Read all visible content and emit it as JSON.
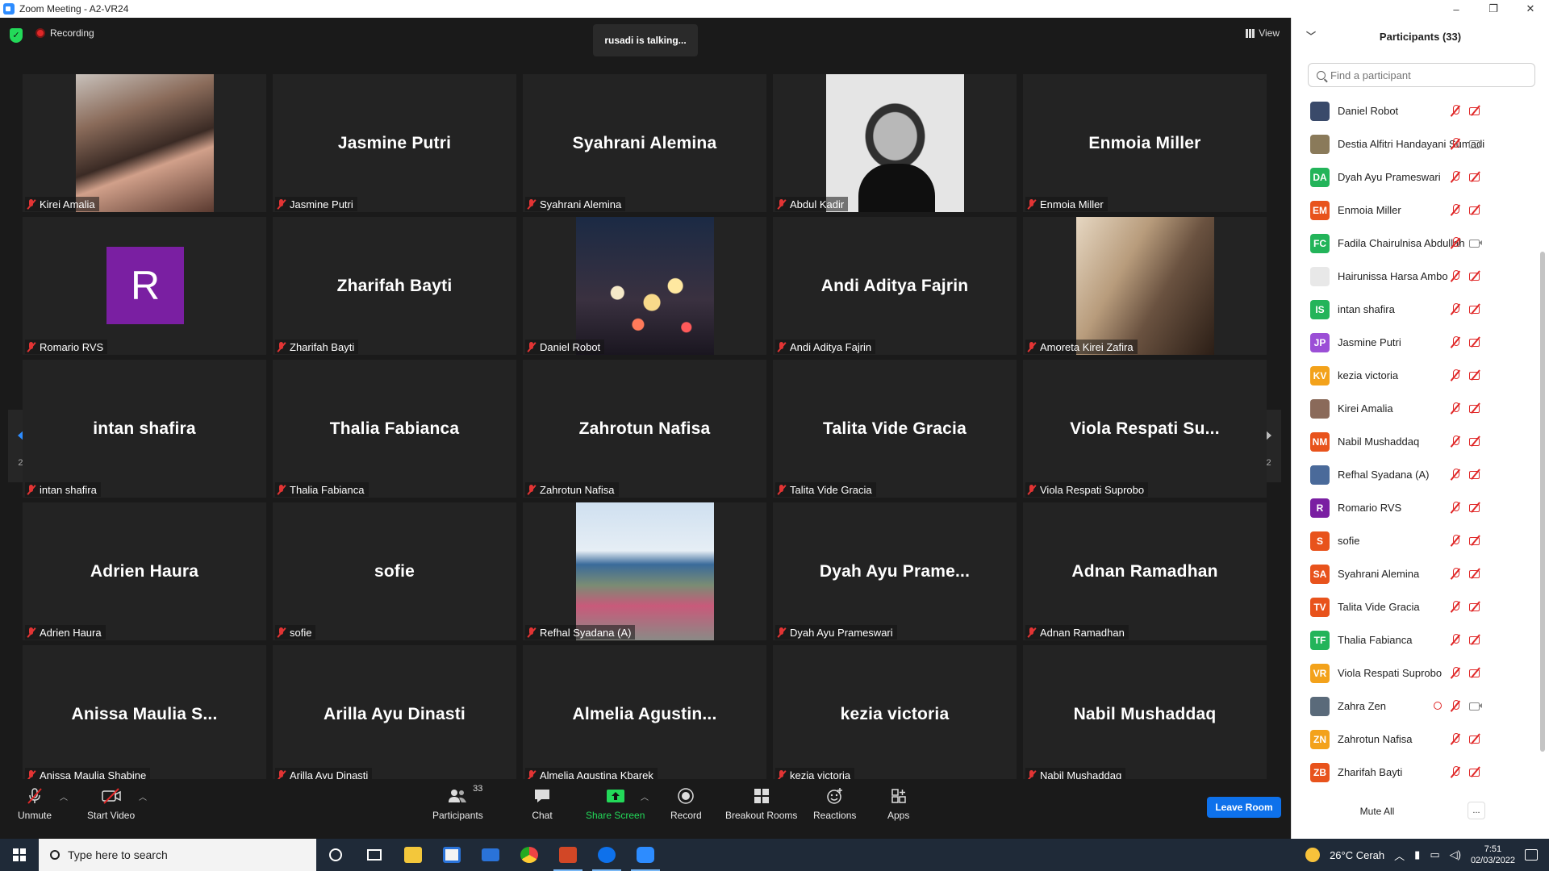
{
  "window": {
    "title": "Zoom Meeting - A2-VR24",
    "minimize": "–",
    "maximize": "❐",
    "close": "✕"
  },
  "topbar": {
    "recording": "Recording",
    "talking": "rusadi is talking...",
    "view": "View"
  },
  "gallery": {
    "page_indicator": "2/2",
    "tiles": [
      {
        "name": "Kirei Amalia",
        "display": "",
        "video": "v-kirei"
      },
      {
        "name": "Jasmine Putri",
        "display": "Jasmine Putri",
        "video": ""
      },
      {
        "name": "Syahrani Alemina",
        "display": "Syahrani Alemina",
        "video": ""
      },
      {
        "name": "Abdul Kadir",
        "display": "",
        "video": "v-abdul"
      },
      {
        "name": "Enmoia Miller",
        "display": "Enmoia Miller",
        "video": ""
      },
      {
        "name": "Romario RVS",
        "display": "",
        "video": "",
        "avatar": "R"
      },
      {
        "name": "Zharifah Bayti",
        "display": "Zharifah Bayti",
        "video": ""
      },
      {
        "name": "Daniel Robot",
        "display": "",
        "video": "v-daniel"
      },
      {
        "name": "Andi Aditya Fajrin",
        "display": "Andi Aditya Fajrin",
        "video": ""
      },
      {
        "name": "Amoreta Kirei Zafira",
        "display": "",
        "video": "v-amoreta"
      },
      {
        "name": "intan shafira",
        "display": "intan shafira",
        "video": ""
      },
      {
        "name": "Thalia Fabianca",
        "display": "Thalia Fabianca",
        "video": ""
      },
      {
        "name": "Zahrotun Nafisa",
        "display": "Zahrotun Nafisa",
        "video": ""
      },
      {
        "name": "Talita Vide Gracia",
        "display": "Talita Vide Gracia",
        "video": ""
      },
      {
        "name": "Viola Respati Suprobo",
        "display": "Viola  Respati  Su...",
        "video": ""
      },
      {
        "name": "Adrien Haura",
        "display": "Adrien Haura",
        "video": ""
      },
      {
        "name": "sofie",
        "display": "sofie",
        "video": ""
      },
      {
        "name": "Refhal Syadana (A)",
        "display": "",
        "video": "v-refhal"
      },
      {
        "name": "Dyah Ayu Prameswari",
        "display": "Dyah  Ayu  Prame...",
        "video": ""
      },
      {
        "name": "Adnan Ramadhan",
        "display": "Adnan Ramadhan",
        "video": ""
      },
      {
        "name": "Anissa Maulia Shabine",
        "display": "Anissa  Maulia  S...",
        "video": ""
      },
      {
        "name": "Arilla Ayu Dinasti",
        "display": "Arilla Ayu Dinasti",
        "video": ""
      },
      {
        "name": "Almelia Agustina Kbarek",
        "display": "Almelia  Agustin...",
        "video": ""
      },
      {
        "name": "kezia victoria",
        "display": "kezia victoria",
        "video": ""
      },
      {
        "name": "Nabil Mushaddaq",
        "display": "Nabil Mushaddaq",
        "video": ""
      }
    ]
  },
  "toolbar": {
    "unmute": "Unmute",
    "start_video": "Start Video",
    "participants": "Participants",
    "participants_count": "33",
    "chat": "Chat",
    "share_screen": "Share Screen",
    "record": "Record",
    "breakout_rooms": "Breakout Rooms",
    "reactions": "Reactions",
    "apps": "Apps",
    "leave": "Leave Room"
  },
  "panel": {
    "title": "Participants (33)",
    "search_placeholder": "Find a participant",
    "mute_all": "Mute All",
    "more": "...",
    "participants": [
      {
        "name": "Daniel Robot",
        "initials": "",
        "color": "#3a4a6a",
        "cam": "off",
        "pin": false
      },
      {
        "name": "Destia Alfitri Handayani Sumadi",
        "initials": "",
        "color": "#8a7a5a",
        "cam": "on",
        "pin": false
      },
      {
        "name": "Dyah Ayu Prameswari",
        "initials": "DA",
        "color": "#23b45a",
        "cam": "off",
        "pin": false
      },
      {
        "name": "Enmoia Miller",
        "initials": "EM",
        "color": "#e8531c",
        "cam": "off",
        "pin": false
      },
      {
        "name": "Fadila Chairulnisa Abdullah",
        "initials": "FC",
        "color": "#23b45a",
        "cam": "on",
        "pin": false
      },
      {
        "name": "Hairunissa Harsa Ambo",
        "initials": "",
        "color": "#e8e8e8",
        "cam": "off",
        "pin": false
      },
      {
        "name": "intan shafira",
        "initials": "IS",
        "color": "#23b45a",
        "cam": "off",
        "pin": false
      },
      {
        "name": "Jasmine Putri",
        "initials": "JP",
        "color": "#9b4fd6",
        "cam": "off",
        "pin": false
      },
      {
        "name": "kezia victoria",
        "initials": "KV",
        "color": "#f3a21b",
        "cam": "off",
        "pin": false
      },
      {
        "name": "Kirei Amalia",
        "initials": "",
        "color": "#8a6a5a",
        "cam": "off",
        "pin": false
      },
      {
        "name": "Nabil Mushaddaq",
        "initials": "NM",
        "color": "#e8531c",
        "cam": "off",
        "pin": false
      },
      {
        "name": "Refhal Syadana (A)",
        "initials": "",
        "color": "#4a6a9a",
        "cam": "off",
        "pin": false
      },
      {
        "name": "Romario RVS",
        "initials": "R",
        "color": "#7a1fa2",
        "cam": "off",
        "pin": false
      },
      {
        "name": "sofie",
        "initials": "S",
        "color": "#e8531c",
        "cam": "off",
        "pin": false
      },
      {
        "name": "Syahrani Alemina",
        "initials": "SA",
        "color": "#e8531c",
        "cam": "off",
        "pin": false
      },
      {
        "name": "Talita Vide Gracia",
        "initials": "TV",
        "color": "#e8531c",
        "cam": "off",
        "pin": false
      },
      {
        "name": "Thalia Fabianca",
        "initials": "TF",
        "color": "#23b45a",
        "cam": "off",
        "pin": false
      },
      {
        "name": "Viola Respati Suprobo",
        "initials": "VR",
        "color": "#f3a21b",
        "cam": "off",
        "pin": false
      },
      {
        "name": "Zahra Zen",
        "initials": "",
        "color": "#5a6a7a",
        "cam": "on",
        "pin": true
      },
      {
        "name": "Zahrotun Nafisa",
        "initials": "ZN",
        "color": "#f3a21b",
        "cam": "off",
        "pin": false
      },
      {
        "name": "Zharifah Bayti",
        "initials": "ZB",
        "color": "#e8531c",
        "cam": "off",
        "pin": false
      }
    ]
  },
  "taskbar": {
    "search_placeholder": "Type here to search",
    "weather": "26°C  Cerah",
    "time": "7:51",
    "date": "02/03/2022"
  }
}
